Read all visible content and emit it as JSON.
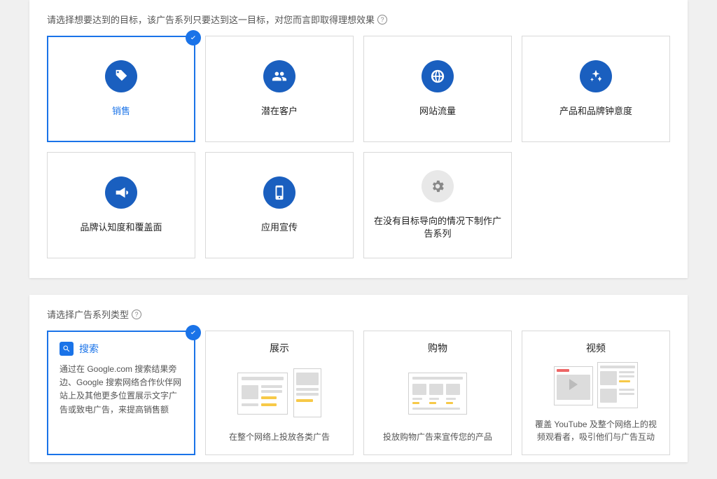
{
  "goal_section": {
    "heading": "请选择想要达到的目标，该广告系列只要达到这一目标，对您而言即取得理想效果",
    "help_tooltip": "?",
    "goals": [
      {
        "id": "sales",
        "label": "销售",
        "icon": "tag-icon",
        "selected": true
      },
      {
        "id": "leads",
        "label": "潜在客户",
        "icon": "people-icon",
        "selected": false
      },
      {
        "id": "traffic",
        "label": "网站流量",
        "icon": "globe-icon",
        "selected": false
      },
      {
        "id": "brand-consideration",
        "label": "产品和品牌钟意度",
        "icon": "sparkle-icon",
        "selected": false
      },
      {
        "id": "brand-awareness",
        "label": "品牌认知度和覆盖面",
        "icon": "megaphone-icon",
        "selected": false
      },
      {
        "id": "app-promo",
        "label": "应用宣传",
        "icon": "phone-icon",
        "selected": false
      },
      {
        "id": "no-goal",
        "label": "在没有目标导向的情况下制作广告系列",
        "icon": "gear-icon",
        "selected": false,
        "grey": true
      }
    ]
  },
  "type_section": {
    "heading": "请选择广告系列类型",
    "help_tooltip": "?",
    "types": [
      {
        "id": "search",
        "title": "搜索",
        "icon": "search-icon",
        "selected": true,
        "description": "通过在 Google.com 搜索结果旁边、Google 搜索网络合作伙伴网站上及其他更多位置展示文字广告或致电广告，来提高销售额"
      },
      {
        "id": "display",
        "title": "展示",
        "selected": false,
        "caption": "在整个网络上投放各类广告"
      },
      {
        "id": "shopping",
        "title": "购物",
        "selected": false,
        "caption": "投放购物广告来宣传您的产品"
      },
      {
        "id": "video",
        "title": "视频",
        "selected": false,
        "caption": "覆盖 YouTube 及整个网络上的视频观看者，吸引他们与广告互动"
      }
    ]
  }
}
